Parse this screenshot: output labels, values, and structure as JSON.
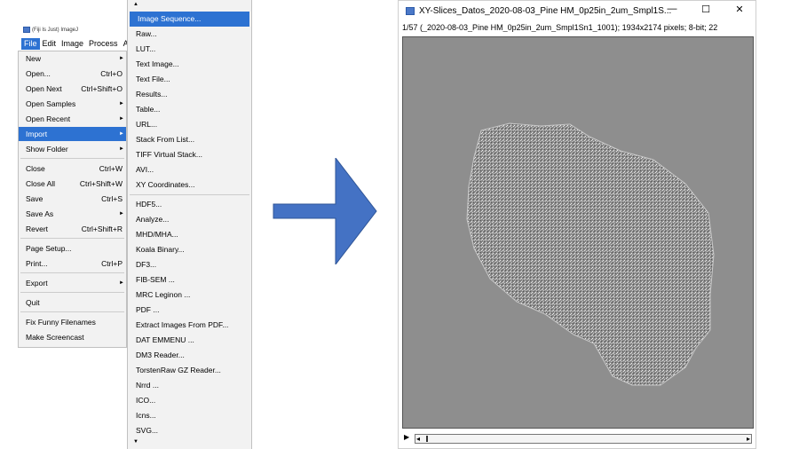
{
  "fiji_window": {
    "title": "(Fiji Is Just) ImageJ",
    "menubar": [
      "File",
      "Edit",
      "Image",
      "Process",
      "A"
    ]
  },
  "file_menu": {
    "items": [
      {
        "label": "New",
        "shortcut": "",
        "submenu": true
      },
      {
        "label": "Open...",
        "shortcut": "Ctrl+O",
        "submenu": false
      },
      {
        "label": "Open Next",
        "shortcut": "Ctrl+Shift+O",
        "submenu": false
      },
      {
        "label": "Open Samples",
        "shortcut": "",
        "submenu": true
      },
      {
        "label": "Open Recent",
        "shortcut": "",
        "submenu": true
      },
      {
        "label": "Import",
        "shortcut": "",
        "submenu": true,
        "highlighted": true
      },
      {
        "label": "Show Folder",
        "shortcut": "",
        "submenu": true
      },
      {
        "label": "Close",
        "shortcut": "Ctrl+W",
        "submenu": false
      },
      {
        "label": "Close All",
        "shortcut": "Ctrl+Shift+W",
        "submenu": false
      },
      {
        "label": "Save",
        "shortcut": "Ctrl+S",
        "submenu": false
      },
      {
        "label": "Save As",
        "shortcut": "",
        "submenu": true
      },
      {
        "label": "Revert",
        "shortcut": "Ctrl+Shift+R",
        "submenu": false
      },
      {
        "label": "Page Setup...",
        "shortcut": "",
        "submenu": false
      },
      {
        "label": "Print...",
        "shortcut": "Ctrl+P",
        "submenu": false
      },
      {
        "label": "Export",
        "shortcut": "",
        "submenu": true
      },
      {
        "label": "Quit",
        "shortcut": "",
        "submenu": false
      },
      {
        "label": "Fix Funny Filenames",
        "shortcut": "",
        "submenu": false
      },
      {
        "label": "Make Screencast",
        "shortcut": "",
        "submenu": false
      }
    ]
  },
  "import_menu": {
    "items": [
      "Image Sequence...",
      "Raw...",
      "LUT...",
      "Text Image...",
      "Text File...",
      "Results...",
      "Table...",
      "URL...",
      "Stack From List...",
      "TIFF Virtual Stack...",
      "AVI...",
      "XY Coordinates...",
      "HDF5...",
      "Analyze...",
      "MHD/MHA...",
      "Koala Binary...",
      "DF3...",
      "FIB-SEM ...",
      "MRC Leginon ...",
      "PDF ...",
      "Extract Images From PDF...",
      "DAT EMMENU ...",
      "DM3 Reader...",
      "TorstenRaw GZ Reader...",
      "Nrrd ...",
      "ICO...",
      "Icns...",
      "SVG..."
    ],
    "scroll_up_glyph": "▲",
    "scroll_down_glyph": "▼"
  },
  "image_window": {
    "title": "XY-Slices_Datos_2020-08-03_Pine HM_0p25in_2um_Smpl1S...",
    "info": "1/57 (_2020-08-03_Pine HM_0p25in_2um_Smpl1Sn1_1001); 1934x2174 pixels; 8-bit; 22",
    "minimize_glyph": "—",
    "maximize_glyph": "☐",
    "close_glyph": "✕",
    "play_glyph": "▶",
    "scroll_left_glyph": "◂",
    "scroll_right_glyph": "▸"
  },
  "colors": {
    "highlight": "#2d72d2",
    "arrow": "#4472c4",
    "image_bg": "#888888"
  }
}
